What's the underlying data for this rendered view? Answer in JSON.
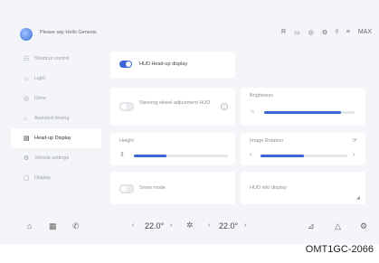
{
  "topbar": {
    "voice_prompt": "Please say Hello Genesis",
    "status_icons": [
      "R",
      "▭",
      "◎",
      "⚙",
      "ᵍ",
      "≡",
      "MAX"
    ]
  },
  "sidebar": {
    "items": [
      {
        "label": "Shortcut control",
        "icon": "☷"
      },
      {
        "label": "Light",
        "icon": "☼"
      },
      {
        "label": "Drive",
        "icon": "◎"
      },
      {
        "label": "Assisted driving",
        "icon": "⌂"
      },
      {
        "label": "Head-up Display",
        "icon": "▤",
        "active": true
      },
      {
        "label": "Vehicle settings",
        "icon": "⚙"
      },
      {
        "label": "Display",
        "icon": "▢"
      }
    ]
  },
  "hud": {
    "hud_main": {
      "label": "HUD Head-up display",
      "on": true
    },
    "steering_adjust": {
      "label": "Steering wheel adjustment HUD",
      "on": false
    },
    "brightness": {
      "label": "Brightness",
      "level": 0.85
    },
    "height": {
      "label": "Height",
      "level": 0.35
    },
    "image_rotation": {
      "label": "Image Rotation",
      "value": "0°",
      "level": 0.5
    },
    "snow_mode": {
      "label": "Snow mode",
      "on": false
    },
    "hud_info": {
      "label": "HUD info display"
    }
  },
  "bottombar": {
    "left_temp": "22.0°",
    "right_temp": "22.0°"
  },
  "caption": "OMT1GC-2066"
}
